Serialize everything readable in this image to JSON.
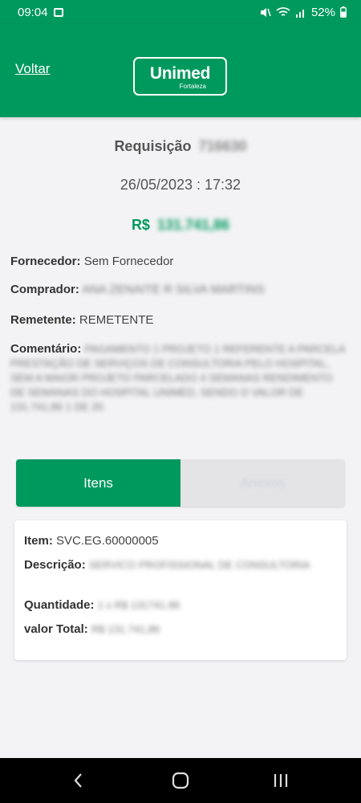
{
  "statusbar": {
    "time": "09:04",
    "battery": "52%"
  },
  "header": {
    "back_label": "Voltar",
    "logo_main": "Unimed",
    "logo_sub": "Fortaleza"
  },
  "request": {
    "title_label": "Requisição",
    "title_number": "716630",
    "datetime": "26/05/2023 : 17:32",
    "currency": "R$",
    "amount": "131.741,86"
  },
  "fields": {
    "fornecedor_label": "Fornecedor:",
    "fornecedor_value": "Sem Fornecedor",
    "comprador_label": "Comprador:",
    "comprador_value": "ANA ZENAITE R SILVA MARTINS",
    "remetente_label": "Remetente:",
    "remetente_value": "REMETENTE",
    "comentario_label": "Comentário:",
    "comentario_value": "PAGAMENTO 1 PROJETO 1 REFERENTE A PARCELA PRESTAÇÃO DE SERVIÇOS DE CONSULTORIA PELO HOSPITAL, SEM A MAIOR PROJETO PARCELADO 4 SEMANAS RENDIMENTO DE SEMANAS DO HOSPITAL UNIMED, SENDO O VALOR DE 131.741,86 1 DE 20."
  },
  "tabs": {
    "items_label": "Itens",
    "attachments_label": "Anexos"
  },
  "item_card": {
    "item_label": "Item:",
    "item_value": "SVC.EG.60000005",
    "descricao_label": "Descrição:",
    "descricao_value": "SERVICO PROFISSIONAL DE CONSULTORIA",
    "quantidade_label": "Quantidade:",
    "quantidade_value": "1 x R$ 131741.86",
    "valor_label": "valor Total:",
    "valor_value": "R$ 131.741,86"
  },
  "colors": {
    "brand_green": "#00995d",
    "tab_inactive": "#e4e4e7",
    "background": "#f3f3f5"
  }
}
